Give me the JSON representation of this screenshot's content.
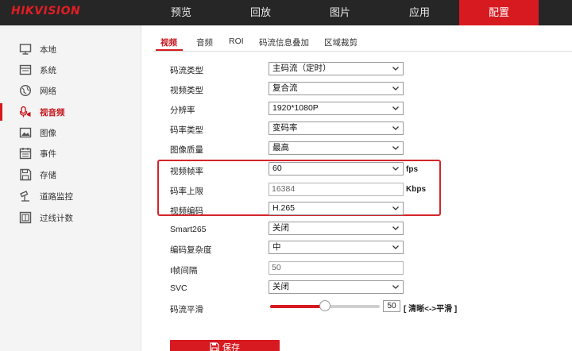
{
  "brand": {
    "logo": "HIKVISION",
    "accent": "#d71920"
  },
  "top_nav": [
    "预览",
    "回放",
    "图片",
    "应用",
    "配置"
  ],
  "top_nav_active": "配置",
  "sidebar": {
    "items": [
      {
        "label": "本地",
        "icon": "monitor-icon"
      },
      {
        "label": "系统",
        "icon": "system-icon"
      },
      {
        "label": "网络",
        "icon": "globe-icon"
      },
      {
        "label": "视音频",
        "icon": "audio-video-icon",
        "active": true
      },
      {
        "label": "图像",
        "icon": "image-icon"
      },
      {
        "label": "事件",
        "icon": "calendar-icon"
      },
      {
        "label": "存储",
        "icon": "storage-icon"
      },
      {
        "label": "道路监控",
        "icon": "road-monitor-icon"
      },
      {
        "label": "过线计数",
        "icon": "line-count-icon"
      }
    ]
  },
  "tabs": [
    "视频",
    "音频",
    "ROI",
    "码流信息叠加",
    "区域裁剪"
  ],
  "tab_active": "视频",
  "form": {
    "stream_type": {
      "label": "码流类型",
      "value": "主码流（定时）"
    },
    "video_type": {
      "label": "视频类型",
      "value": "复合流"
    },
    "resolution": {
      "label": "分辨率",
      "value": "1920*1080P"
    },
    "bitrate_type": {
      "label": "码率类型",
      "value": "变码率"
    },
    "image_quality": {
      "label": "图像质量",
      "value": "最高"
    },
    "frame_rate": {
      "label": "视频帧率",
      "value": "60",
      "unit": "fps"
    },
    "max_bitrate": {
      "label": "码率上限",
      "value": "16384",
      "unit": "Kbps"
    },
    "video_encoding": {
      "label": "视频编码",
      "value": "H.265"
    },
    "smart265": {
      "label": "Smart265",
      "value": "关闭"
    },
    "encoding_complexity": {
      "label": "编码复杂度",
      "value": "中"
    },
    "i_frame_interval": {
      "label": "I帧间隔",
      "value": "50"
    },
    "svc": {
      "label": "SVC",
      "value": "关闭"
    },
    "stream_smoothing": {
      "label": "码流平滑",
      "value": "50",
      "fraction": 0.5,
      "hint": "[ 清晰<->平滑 ]"
    }
  },
  "save_label": "保存"
}
